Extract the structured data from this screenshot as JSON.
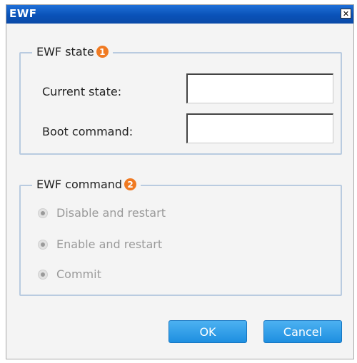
{
  "window": {
    "title": "EWF",
    "close_symbol": "✕"
  },
  "ewf_state": {
    "legend": "EWF state",
    "badge": "1",
    "current_state": {
      "label": "Current state:",
      "value": ""
    },
    "boot_command": {
      "label": "Boot command:",
      "value": ""
    }
  },
  "ewf_command": {
    "legend": "EWF command",
    "badge": "2",
    "options": [
      {
        "label": "Disable and restart"
      },
      {
        "label": "Enable and restart"
      },
      {
        "label": "Commit"
      }
    ]
  },
  "buttons": {
    "ok": "OK",
    "cancel": "Cancel"
  },
  "colors": {
    "titlebar": "#0a52b8",
    "group_border": "#b9cbe0",
    "badge": "#f07a22",
    "button": "#1e8fe0",
    "disabled_text": "#9a9a9a"
  }
}
